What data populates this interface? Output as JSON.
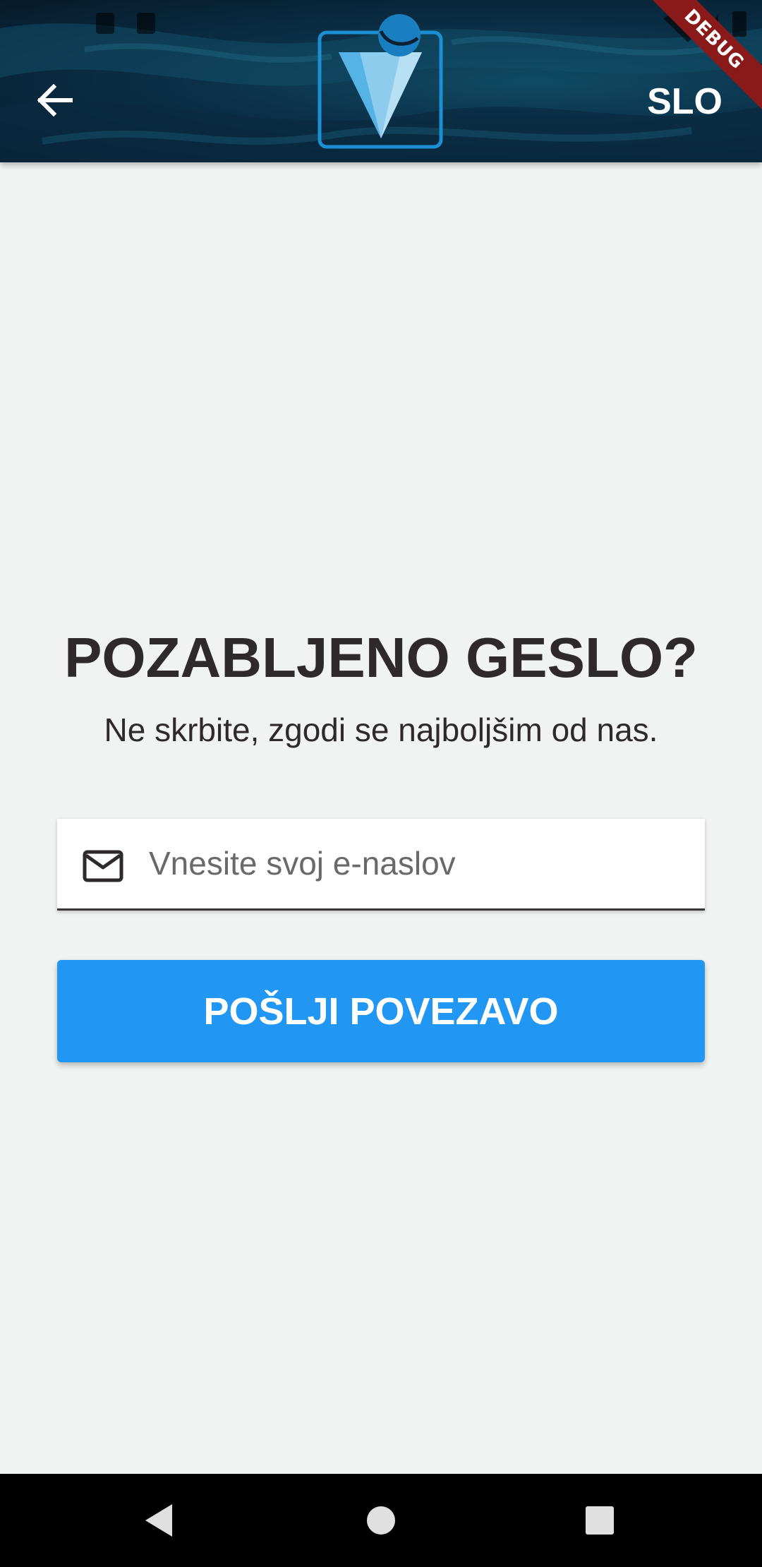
{
  "header": {
    "language_label": "SLO",
    "debug_banner": "DEBUG",
    "back_icon": "arrow-left-icon",
    "logo_icon": "v-logo-icon"
  },
  "status_bar": {
    "icons": [
      "notification-icon",
      "notification-icon",
      "wifi-icon",
      "signal-icon",
      "battery-icon"
    ]
  },
  "main": {
    "title": "POZABLJENO GESLO?",
    "subtitle": "Ne skrbite, zgodi se najboljšim od nas.",
    "email_field": {
      "icon": "mail-icon",
      "value": "",
      "placeholder": "Vnesite svoj e-naslov"
    },
    "send_button_label": "POŠLJI POVEZAVO"
  },
  "nav_bar": {
    "back_icon": "nav-back-icon",
    "home_icon": "nav-home-icon",
    "recents_icon": "nav-recents-icon"
  },
  "colors": {
    "accent": "#2196f2",
    "background": "#f1f2f2",
    "text": "#2e2a2b",
    "header_dark": "#0b3048",
    "debug_banner": "#8a1a1a"
  }
}
